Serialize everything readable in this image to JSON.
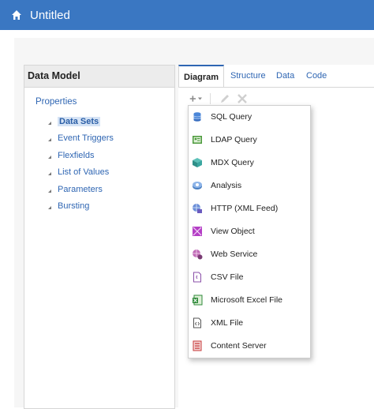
{
  "header": {
    "title": "Untitled",
    "home_icon": "home-icon"
  },
  "left_panel": {
    "title": "Data Model",
    "properties_label": "Properties",
    "tree": [
      {
        "label": "Data Sets",
        "selected": true
      },
      {
        "label": "Event Triggers"
      },
      {
        "label": "Flexfields"
      },
      {
        "label": "List of Values"
      },
      {
        "label": "Parameters"
      },
      {
        "label": "Bursting"
      }
    ]
  },
  "tabs": [
    {
      "label": "Diagram",
      "active": true
    },
    {
      "label": "Structure"
    },
    {
      "label": "Data"
    },
    {
      "label": "Code"
    }
  ],
  "toolbar": {
    "add_icon": "add-icon",
    "edit_icon": "pencil-icon",
    "delete_icon": "delete-icon"
  },
  "menu": {
    "items": [
      {
        "label": "SQL Query",
        "icon": "database-icon",
        "color": "#4a86d8"
      },
      {
        "label": "LDAP Query",
        "icon": "ldap-icon",
        "color": "#4c9a3c"
      },
      {
        "label": "MDX Query",
        "icon": "cube-icon",
        "color": "#3aa6a0"
      },
      {
        "label": "Analysis",
        "icon": "analysis-icon",
        "color": "#4a7fc1"
      },
      {
        "label": "HTTP (XML Feed)",
        "icon": "http-icon",
        "color": "#6b5bbf"
      },
      {
        "label": "View Object",
        "icon": "view-object-icon",
        "color": "#b43ec5"
      },
      {
        "label": "Web Service",
        "icon": "web-service-icon",
        "color": "#a8499e"
      },
      {
        "label": "CSV File",
        "icon": "csv-file-icon",
        "color": "#8a4fa8"
      },
      {
        "label": "Microsoft Excel File",
        "icon": "excel-icon",
        "color": "#2f8a3a"
      },
      {
        "label": "XML File",
        "icon": "xml-file-icon",
        "color": "#555555"
      },
      {
        "label": "Content Server",
        "icon": "content-server-icon",
        "color": "#c73a3a"
      }
    ]
  }
}
